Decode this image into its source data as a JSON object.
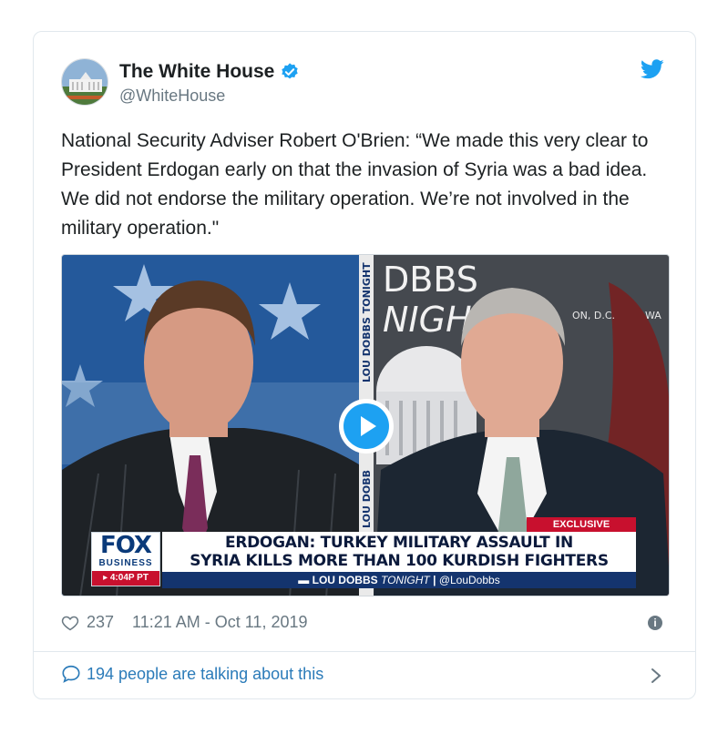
{
  "author": {
    "name": "The White House",
    "handle": "@WhiteHouse",
    "verified": true
  },
  "tweet": {
    "text": "National Security Adviser Robert O'Brien: “We made this very clear to President Erdogan early on that the invasion of Syria was a bad idea. We did not endorse the military operation. We’re not involved in the military operation.\""
  },
  "video": {
    "backdrop_text": "DBBS",
    "backdrop_text_2": "NIGH",
    "backdrop_small": "ON, D.C.",
    "backdrop_small_2": "WA",
    "side_strip": "LOU DOBBS TONIGHT",
    "side_strip_2": "LOU DOBB",
    "network_logo": "FOX",
    "network_sub": "BUSINESS",
    "time_badge": "▸ 4:04P PT",
    "exclusive_label": "EXCLUSIVE",
    "headline_line1": "ERDOGAN: TURKEY MILITARY ASSAULT IN",
    "headline_line2": "SYRIA KILLS MORE THAN 100 KURDISH FIGHTERS",
    "show_name": "LOU DOBBS",
    "show_name_2": "TONIGHT",
    "show_handle": "@LouDobbs"
  },
  "meta": {
    "likes": "237",
    "timestamp": "11:21 AM - Oct 11, 2019"
  },
  "conversation": {
    "label": "194 people are talking about this"
  },
  "colors": {
    "twitter_blue": "#1da1f2",
    "link_blue": "#2b7bb9",
    "muted_gray": "#697882",
    "fox_red": "#c8102e",
    "fox_navy": "#14346e"
  }
}
